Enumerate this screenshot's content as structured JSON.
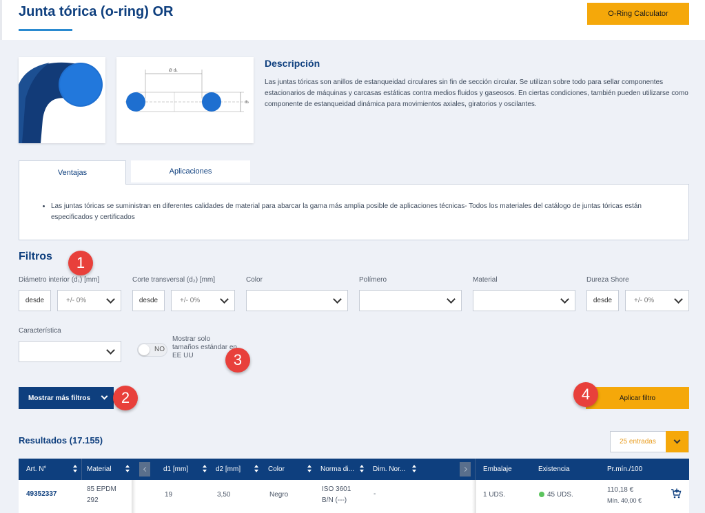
{
  "header": {
    "title": "Junta tórica (o-ring) OR",
    "calculator_button": "O-Ring Calculator"
  },
  "product": {
    "drawing_labels": {
      "d1": "Ø d₁",
      "d2": "d₂"
    },
    "description_title": "Descripción",
    "description_text": "Las juntas tóricas son anillos de estanqueidad circulares sin fin de sección circular. Se utilizan sobre todo para sellar componentes estacionarios de máquinas y carcasas estáticas contra medios fluidos y gaseosos. En ciertas condiciones, también pueden utilizarse como componente de estanqueidad dinámica para movimientos axiales, giratorios y oscilantes."
  },
  "tabs": {
    "items": [
      "Ventajas",
      "Aplicaciones"
    ],
    "active": "Ventajas",
    "panel_bullet": "Las juntas tóricas se suministran en diferentes calidades de material para abarcar la gama más amplia posible de aplicaciones técnicas- Todos los materiales del catálogo de juntas tóricas están especificados y certificados"
  },
  "filters": {
    "title": "Filtros",
    "inner_diameter": {
      "label": "Diámetro interior (d₁) [mm]",
      "from": "desde",
      "tolerance": "+/- 0%"
    },
    "cross_section": {
      "label": "Corte transversal (d₂) [mm]",
      "from": "desde",
      "tolerance": "+/- 0%"
    },
    "color": {
      "label": "Color",
      "value": ""
    },
    "polymer": {
      "label": "Polímero",
      "value": ""
    },
    "material": {
      "label": "Material",
      "value": ""
    },
    "hardness": {
      "label": "Dureza Shore",
      "from": "desde",
      "tolerance": "+/- 0%"
    },
    "characteristic": {
      "label": "Característica",
      "value": ""
    },
    "toggle": {
      "state": "NO",
      "label": "Mostrar solo tamaños estándar en EE UU"
    },
    "more_button": "Mostrar más filtros",
    "apply_button": "Aplicar filtro"
  },
  "badges": [
    "1",
    "2",
    "3",
    "4"
  ],
  "results": {
    "title": "Resultados (17.155)",
    "entries": "25 entradas",
    "columns": [
      "Art. N°",
      "Material",
      "d1 [mm]",
      "d2 [mm]",
      "Color",
      "Norma di...",
      "Dim. Nor...",
      "Embalaje",
      "Existencia",
      "Pr.mín./100"
    ],
    "rows": [
      {
        "art_no": "49352337",
        "material_line1": "85 EPDM",
        "material_line2": "292",
        "d1": "19",
        "d2": "3,50",
        "color": "Negro",
        "norm_line1": "ISO 3601",
        "norm_line2": "B/N (---)",
        "dim_norm": "-",
        "packaging": "1 UDS.",
        "stock": "45 UDS.",
        "price": "110,18 €",
        "min_price": "Mín. 40,00 €"
      }
    ]
  },
  "colors": {
    "primary": "#0e3f7e",
    "accent": "#f5a80a",
    "badge": "#e8403b",
    "in_stock": "#5cc45e"
  }
}
